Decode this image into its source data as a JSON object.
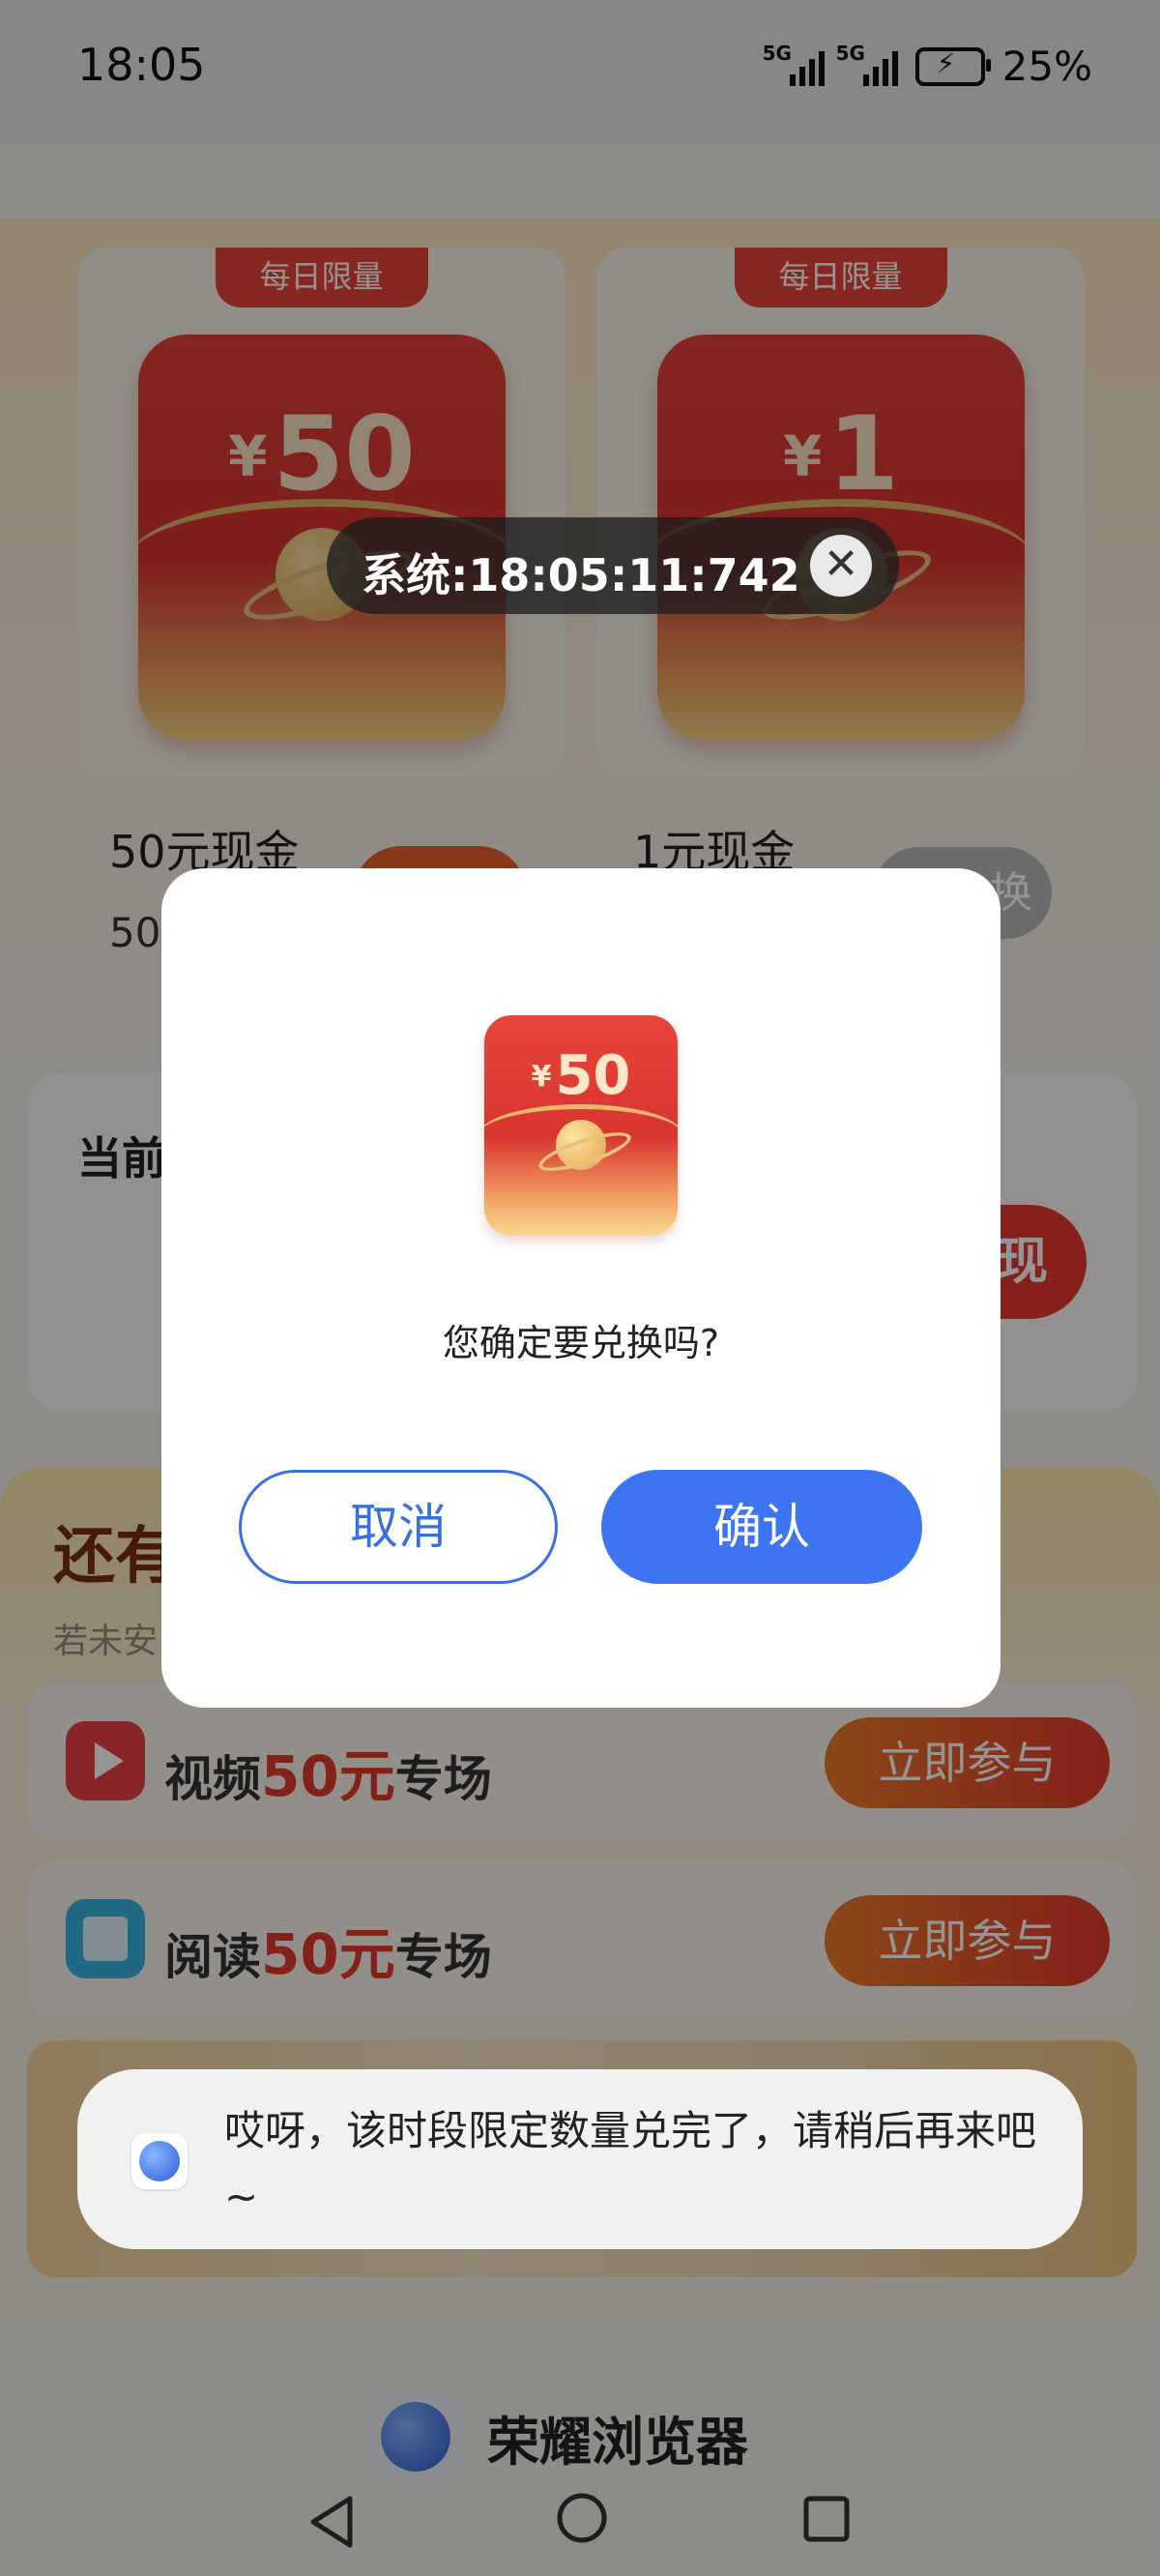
{
  "status_bar": {
    "time": "18:05",
    "net1": "5G",
    "net2": "5G",
    "battery": "25%"
  },
  "prizes": [
    {
      "tag": "每日限量",
      "amount": "50",
      "currency": "¥",
      "name": "50元现金",
      "sub": "50"
    },
    {
      "tag": "每日限量",
      "amount": "1",
      "currency": "¥",
      "name": "1元现金",
      "button_partial": "换"
    }
  ],
  "balance": {
    "title_partial": "当前",
    "withdraw_partial": "现"
  },
  "tasks": {
    "title_partial": "还有",
    "subtitle_partial": "若未安",
    "items": [
      {
        "prefix": "视频",
        "highlight": "50元",
        "suffix": "专场",
        "button": "立即参与"
      },
      {
        "prefix": "阅读",
        "highlight": "50元",
        "suffix": "专场",
        "button": "立即参与"
      }
    ]
  },
  "footer": {
    "brand": "荣耀浏览器"
  },
  "system_time": {
    "text": "系统:18:05:11:742",
    "close": "✕"
  },
  "dialog": {
    "currency": "¥",
    "amount": "50",
    "message": "您确定要兑换吗?",
    "cancel": "取消",
    "confirm": "确认"
  },
  "toast": {
    "message": "哎呀，该时段限定数量兑完了，请稍后再来吧~"
  }
}
